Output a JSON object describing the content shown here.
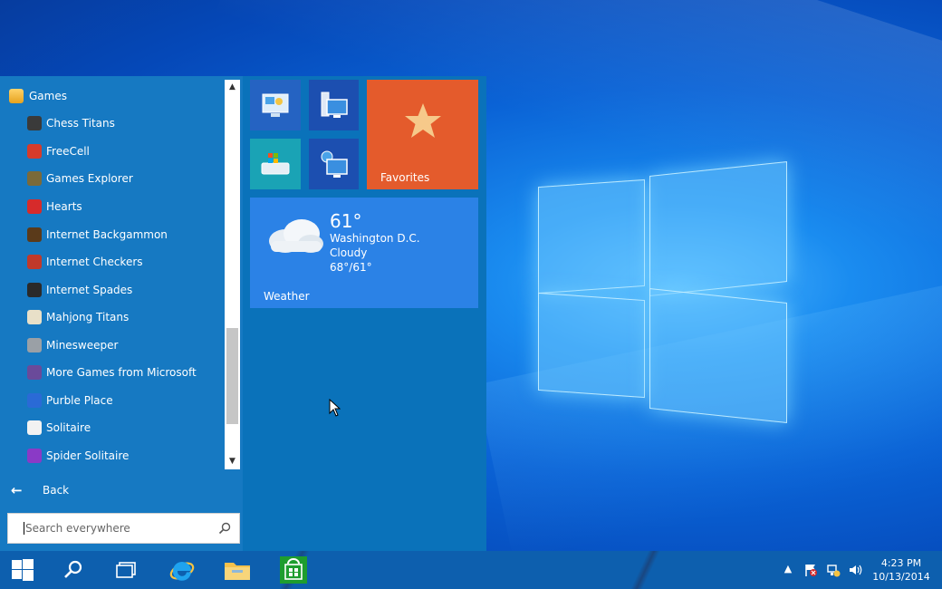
{
  "start_menu": {
    "folder_label": "Games",
    "apps": [
      {
        "label": "Chess Titans",
        "color": "#3a3a3a"
      },
      {
        "label": "FreeCell",
        "color": "#d63b2b"
      },
      {
        "label": "Games Explorer",
        "color": "#7a6a3a"
      },
      {
        "label": "Hearts",
        "color": "#d62b2b"
      },
      {
        "label": "Internet Backgammon",
        "color": "#5a3a1a"
      },
      {
        "label": "Internet Checkers",
        "color": "#c0392b"
      },
      {
        "label": "Internet Spades",
        "color": "#2a2a2a"
      },
      {
        "label": "Mahjong Titans",
        "color": "#e8e0c8"
      },
      {
        "label": "Minesweeper",
        "color": "#9aa0a6"
      },
      {
        "label": "More Games from Microsoft",
        "color": "#6a4a9a"
      },
      {
        "label": "Purble Place",
        "color": "#2a6ad6"
      },
      {
        "label": "Solitaire",
        "color": "#f2f2f2"
      },
      {
        "label": "Spider Solitaire",
        "color": "#8a3ac6"
      }
    ],
    "back_label": "Back",
    "search_placeholder": "Search everywhere"
  },
  "tiles": {
    "favorites_label": "Favorites",
    "weather": {
      "label": "Weather",
      "temperature": "61°",
      "city": "Washington D.C.",
      "condition": "Cloudy",
      "range": "68°/61°"
    }
  },
  "taskbar": {
    "time": "4:23 PM",
    "date": "10/13/2014"
  },
  "colors": {
    "start_bg": "#0a72ba",
    "app_list_bg": "#1679c2",
    "favorites_tile": "#e45b2c",
    "weather_tile": "#2b82e6",
    "taskbar": "#0d5fae"
  }
}
